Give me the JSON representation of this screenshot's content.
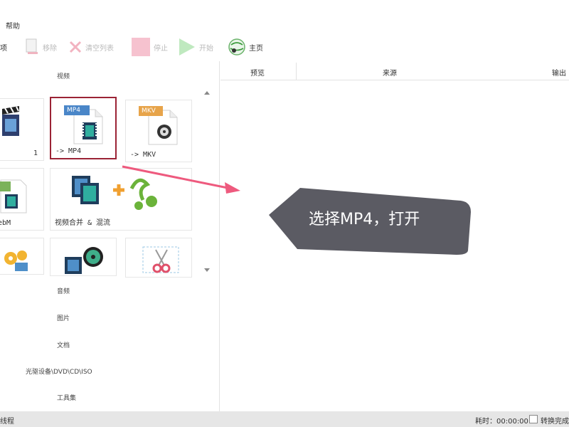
{
  "menu": {
    "help": "帮助"
  },
  "toolbar": {
    "partial_left": "项",
    "remove": "移除",
    "clear": "清空列表",
    "stop": "停止",
    "start": "开始",
    "home": "主页"
  },
  "left_panel": {
    "cat_video": "视频",
    "cat_audio": "音频",
    "cat_image": "图片",
    "cat_doc": "文档",
    "cat_disc": "光驱设备\\DVD\\CD\\ISO",
    "cat_tools": "工具集",
    "tiles": [
      {
        "caption": "1"
      },
      {
        "caption": "-> MP4",
        "badge": "MP4"
      },
      {
        "caption": "-> MKV",
        "badge": "MKV"
      },
      {
        "caption": "ebM"
      },
      {
        "caption": "视频合并 & 混流"
      },
      {
        "caption": ""
      },
      {
        "caption": ""
      },
      {
        "caption": ""
      }
    ]
  },
  "table": {
    "col_preview": "预览",
    "col_source": "来源",
    "col_output": "输出"
  },
  "callout": {
    "text": "选择MP4，打开"
  },
  "status": {
    "left": "线程",
    "elapsed": "耗时：00:00:00",
    "done_checkbox": "转换完成"
  },
  "colors": {
    "selected_border": "#9b2335",
    "callout_bg": "#5b5b63",
    "arrow": "#ee5a7e"
  }
}
